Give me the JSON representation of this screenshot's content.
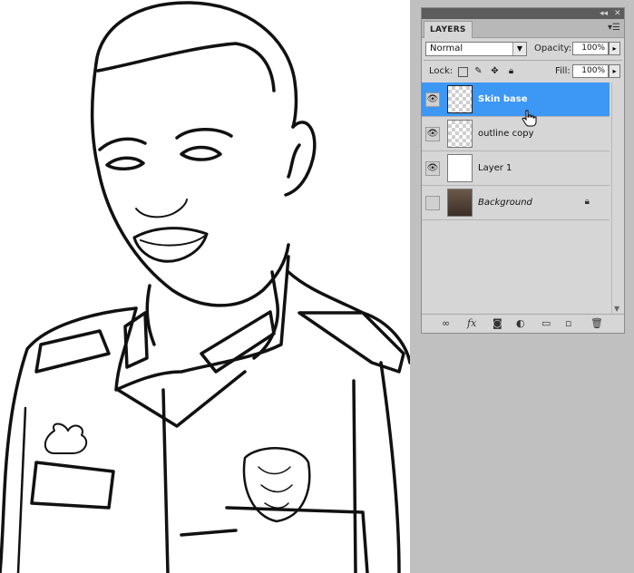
{
  "panel": {
    "tab": "LAYERS",
    "blend_mode": "Normal",
    "opacity_label": "Opacity:",
    "opacity_value": "100%",
    "lock_label": "Lock:",
    "fill_label": "Fill:",
    "fill_value": "100%"
  },
  "layers": [
    {
      "name": "Skin base",
      "visible": true,
      "selected": true,
      "thumb": "transparent"
    },
    {
      "name": "outline copy",
      "visible": true,
      "selected": false,
      "thumb": "transparent-sketch"
    },
    {
      "name": "Layer 1",
      "visible": true,
      "selected": false,
      "thumb": "white"
    },
    {
      "name": "Background",
      "visible": false,
      "selected": false,
      "thumb": "photo",
      "locked": true
    }
  ],
  "colors": {
    "selection": "#3d97f5",
    "panel": "#d6d6d6",
    "workspace": "#c0c0c0"
  }
}
